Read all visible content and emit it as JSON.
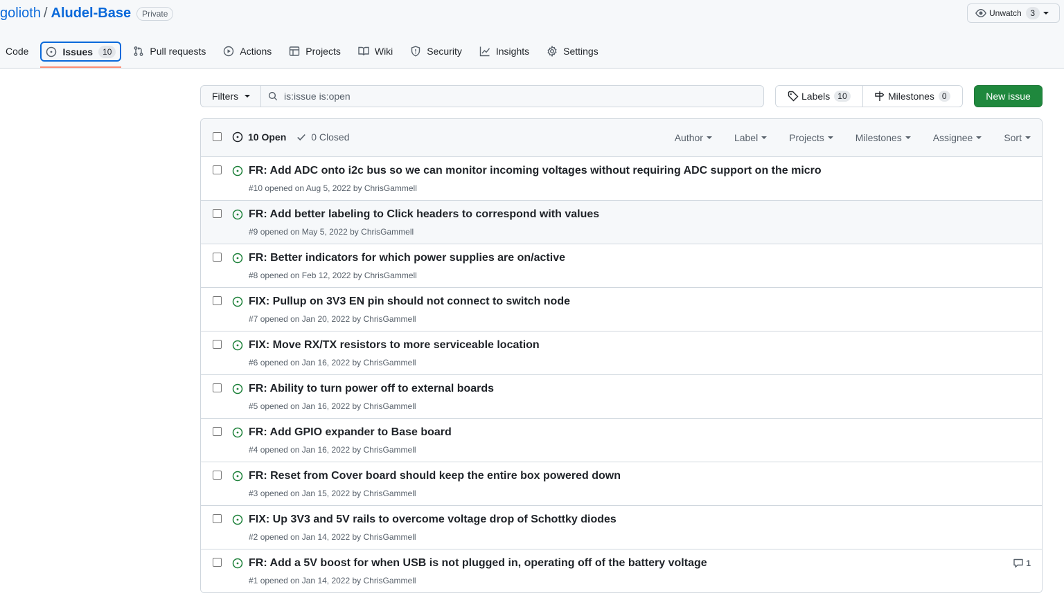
{
  "repo": {
    "owner": "golioth",
    "separator": "/",
    "name": "Aludel-Base",
    "visibility": "Private"
  },
  "watch": {
    "label": "Unwatch",
    "count": "3"
  },
  "nav": [
    {
      "label": "Code",
      "icon": "code-icon"
    },
    {
      "label": "Issues",
      "icon": "issue-opened-icon",
      "count": "10",
      "selected": true
    },
    {
      "label": "Pull requests",
      "icon": "git-pull-request-icon"
    },
    {
      "label": "Actions",
      "icon": "play-icon"
    },
    {
      "label": "Projects",
      "icon": "table-icon"
    },
    {
      "label": "Wiki",
      "icon": "book-icon"
    },
    {
      "label": "Security",
      "icon": "shield-icon"
    },
    {
      "label": "Insights",
      "icon": "graph-icon"
    },
    {
      "label": "Settings",
      "icon": "gear-icon"
    }
  ],
  "toolbar": {
    "filters_label": "Filters",
    "search_value": "is:issue is:open",
    "labels_label": "Labels",
    "labels_count": "10",
    "milestones_label": "Milestones",
    "milestones_count": "0",
    "new_issue_label": "New issue"
  },
  "list_header": {
    "open_label": "10 Open",
    "closed_label": "0 Closed",
    "filters": [
      "Author",
      "Label",
      "Projects",
      "Milestones",
      "Assignee",
      "Sort"
    ]
  },
  "issues": [
    {
      "title": "FR: Add ADC onto i2c bus so we can monitor incoming voltages without requiring ADC support on the micro",
      "number": "#10",
      "opened": "opened on Aug 5, 2022 by",
      "author": "ChrisGammell",
      "comments": ""
    },
    {
      "title": "FR: Add better labeling to Click headers to correspond with values",
      "number": "#9",
      "opened": "opened on May 5, 2022 by",
      "author": "ChrisGammell",
      "comments": ""
    },
    {
      "title": "FR: Better indicators for which power supplies are on/active",
      "number": "#8",
      "opened": "opened on Feb 12, 2022 by",
      "author": "ChrisGammell",
      "comments": ""
    },
    {
      "title": "FIX: Pullup on 3V3 EN pin should not connect to switch node",
      "number": "#7",
      "opened": "opened on Jan 20, 2022 by",
      "author": "ChrisGammell",
      "comments": ""
    },
    {
      "title": "FIX: Move RX/TX resistors to more serviceable location",
      "number": "#6",
      "opened": "opened on Jan 16, 2022 by",
      "author": "ChrisGammell",
      "comments": ""
    },
    {
      "title": "FR: Ability to turn power off to external boards",
      "number": "#5",
      "opened": "opened on Jan 16, 2022 by",
      "author": "ChrisGammell",
      "comments": ""
    },
    {
      "title": "FR: Add GPIO expander to Base board",
      "number": "#4",
      "opened": "opened on Jan 16, 2022 by",
      "author": "ChrisGammell",
      "comments": ""
    },
    {
      "title": "FR: Reset from Cover board should keep the entire box powered down",
      "number": "#3",
      "opened": "opened on Jan 15, 2022 by",
      "author": "ChrisGammell",
      "comments": ""
    },
    {
      "title": "FIX: Up 3V3 and 5V rails to overcome voltage drop of Schottky diodes",
      "number": "#2",
      "opened": "opened on Jan 14, 2022 by",
      "author": "ChrisGammell",
      "comments": ""
    },
    {
      "title": "FR: Add a 5V boost for when USB is not plugged in, operating off of the battery voltage",
      "number": "#1",
      "opened": "opened on Jan 14, 2022 by",
      "author": "ChrisGammell",
      "comments": "1"
    }
  ],
  "colors": {
    "link": "#0969da",
    "open_green": "#1a7f37",
    "primary_button": "#1f883d",
    "nav_underline": "#fd8c73",
    "border": "#d0d7de",
    "muted_text": "#57606a"
  }
}
